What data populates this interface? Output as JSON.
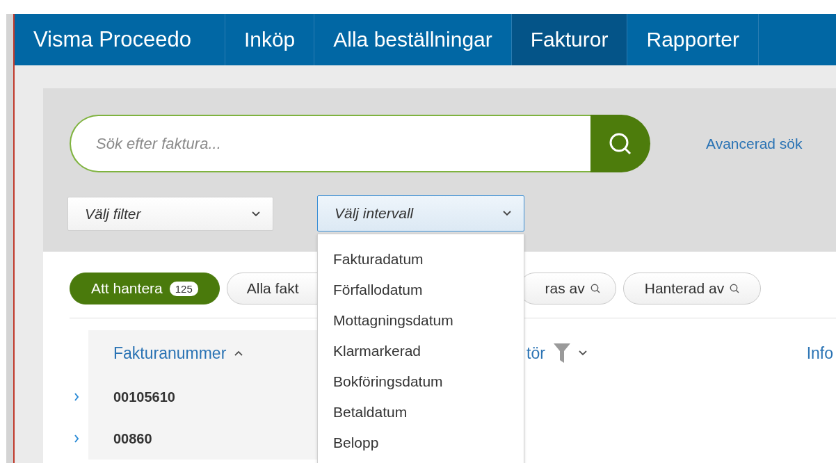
{
  "nav": {
    "brand": "Visma Proceedo",
    "items": [
      {
        "label": "Inköp",
        "selected": false
      },
      {
        "label": "Alla beställningar",
        "selected": false
      },
      {
        "label": "Fakturor",
        "selected": true
      },
      {
        "label": "Rapporter",
        "selected": false
      }
    ]
  },
  "search": {
    "placeholder": "Sök efter faktura...",
    "advanced_link": "Avancerad sök"
  },
  "filters": [
    {
      "label": "Välj filter",
      "expanded": false
    },
    {
      "label": "Välj intervall",
      "expanded": true,
      "options": [
        "Fakturadatum",
        "Förfallodatum",
        "Mottagningsdatum",
        "Klarmarkerad",
        "Bokföringsdatum",
        "Betaldatum",
        "Belopp"
      ]
    }
  ],
  "chips": [
    {
      "label": "Att hantera",
      "count": "125",
      "selected": true,
      "search": false
    },
    {
      "label": "Alla fakt",
      "selected": false,
      "search": false
    },
    {
      "label": "ras av",
      "selected": false,
      "search": true
    },
    {
      "label": "Hanterad av",
      "selected": false,
      "search": true
    }
  ],
  "table": {
    "columns": [
      {
        "label": "Fakturanummer",
        "sorted": true,
        "filter": false
      },
      {
        "label": "tör",
        "sorted": false,
        "filter": true
      },
      {
        "label": "Info",
        "sorted": false,
        "filter": false
      }
    ],
    "rows": [
      {
        "number": "00105610",
        "expanded": false
      },
      {
        "number": "00860",
        "expanded": false
      }
    ]
  }
}
